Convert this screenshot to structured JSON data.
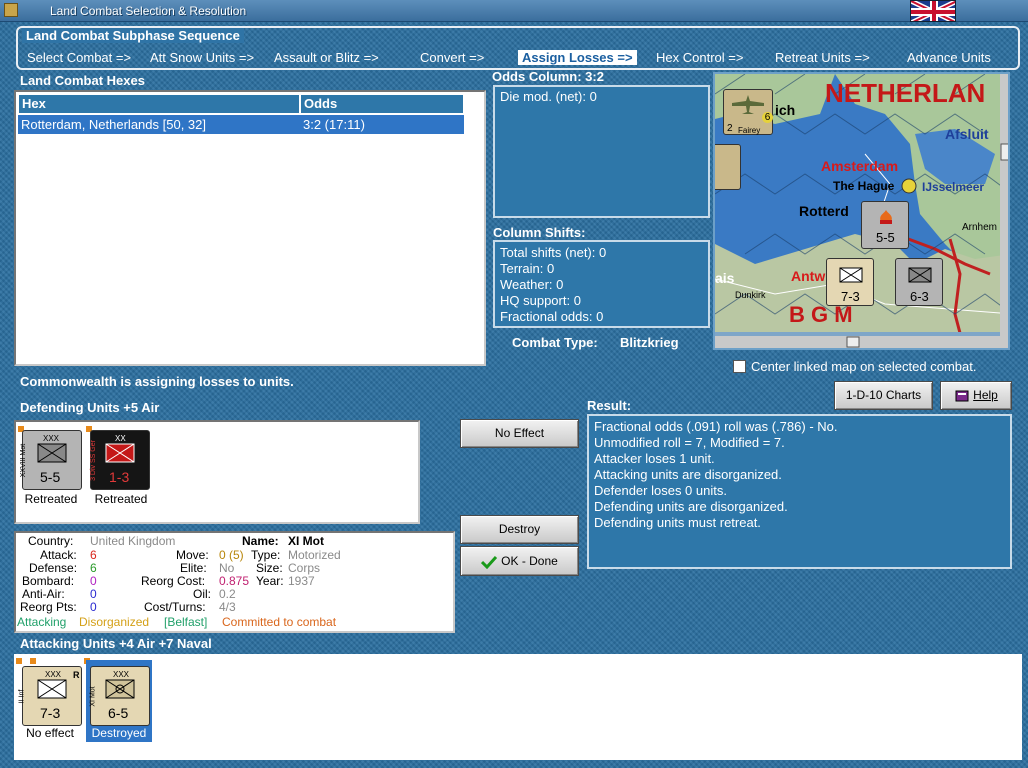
{
  "window": {
    "title": "Land Combat Selection & Resolution"
  },
  "sequence": {
    "title": "Land Combat Subphase Sequence",
    "phases": [
      {
        "label": "Select Combat =>"
      },
      {
        "label": "Att Snow Units =>"
      },
      {
        "label": "Assault or Blitz =>"
      },
      {
        "label": "Convert =>"
      },
      {
        "label": "Assign Losses =>"
      },
      {
        "label": "Hex Control =>"
      },
      {
        "label": "Retreat Units =>"
      },
      {
        "label": "Advance Units"
      }
    ],
    "active_index": 4
  },
  "hexes": {
    "title": "Land Combat Hexes",
    "columns": [
      "Hex",
      "Odds"
    ],
    "rows": [
      {
        "hex": "Rotterdam, Netherlands [50, 32]",
        "odds": "3:2 (17:11)"
      }
    ]
  },
  "odds": {
    "title": "Odds Column: 3:2",
    "die_mod": "Die mod. (net): 0"
  },
  "shifts": {
    "title": "Column Shifts:",
    "lines": [
      "Total shifts (net): 0",
      "Terrain: 0",
      "Weather: 0",
      "HQ support: 0",
      "Fractional odds: 0"
    ]
  },
  "combat_type": {
    "label": "Combat Type:",
    "value": "Blitzkrieg"
  },
  "map": {
    "labels": {
      "netherlands": "NETHERLAN",
      "amsterdam": "Amsterdam",
      "the_hague": "The Hague",
      "ijsselmeer": "IJsselmeer",
      "rotterdam": "Rotterd",
      "afsluit": "Afsluit",
      "arnhem": "Arnhem",
      "antw": "Antw",
      "dunkirk": "Dunkirk",
      "ais": "ais",
      "ich": "ich",
      "belgium": "B   G  M"
    },
    "counters": {
      "fairey": {
        "name": "Fairey",
        "top": "2",
        "right": "6"
      },
      "mid_unit": {
        "value": "5-5"
      },
      "left_unit": {
        "value": "7-3"
      },
      "right_unit": {
        "value": "6-3"
      }
    },
    "center_checkbox": "Center linked map on selected combat.",
    "center_checked": false
  },
  "status_message": "Commonwealth is assigning losses to units.",
  "defending": {
    "title": "Defending Units +5 Air",
    "units": [
      {
        "value": "5-5",
        "side": "XXVIII Mot",
        "size": "XXX",
        "label": "Retreated",
        "color": "#b4b4b4"
      },
      {
        "value": "1-3",
        "side": "3 Div SS Ger",
        "size": "XX",
        "label": "Retreated",
        "color": "#151515"
      }
    ]
  },
  "buttons": {
    "charts": "1-D-10 Charts",
    "help": "Help",
    "no_effect": "No Effect",
    "destroy": "Destroy",
    "ok_done": "OK - Done"
  },
  "result": {
    "title": "Result:",
    "lines": [
      "Fractional odds (.091) roll was (.786)  - No.",
      "Unmodified roll = 7, Modified = 7.",
      "Attacker loses 1 unit.",
      "Attacking units are disorganized.",
      "Defender loses 0 units.",
      "Defending units are disorganized.",
      "Defending units must retreat."
    ]
  },
  "unit_info": {
    "country_label": "Country:",
    "country": "United Kingdom",
    "name_label": "Name:",
    "name": "XI Mot",
    "attack_label": "Attack:",
    "attack": "6",
    "move_label": "Move:",
    "move": "0 (5)",
    "type_label": "Type:",
    "type": "Motorized",
    "defense_label": "Defense:",
    "defense": "6",
    "elite_label": "Elite:",
    "elite": "No",
    "size_label": "Size:",
    "size": "Corps",
    "bombard_label": "Bombard:",
    "bombard": "0",
    "reorg_cost_label": "Reorg Cost:",
    "reorg_cost": "0.875",
    "year_label": "Year:",
    "year": "1937",
    "antiair_label": "Anti-Air:",
    "antiair": "0",
    "oil_label": "Oil:",
    "oil": "0.2",
    "reorg_pts_label": "Reorg Pts:",
    "reorg_pts": "0",
    "cost_turns_label": "Cost/Turns:",
    "cost_turns": "4/3",
    "status_attacking": "Attacking",
    "status_disorganized": "Disorganized",
    "status_location": "[Belfast]",
    "status_committed": "Committed to combat"
  },
  "attacking": {
    "title": "Attacking Units +4 Air +7 Naval",
    "units": [
      {
        "value": "7-3",
        "side": "II Inf",
        "size": "XXX",
        "flag": "R",
        "label": "No effect",
        "selected": false
      },
      {
        "value": "6-5",
        "side": "XI Mot",
        "size": "XXX",
        "flag": "",
        "label": "Destroyed",
        "selected": true
      }
    ]
  },
  "colors": {
    "attack": "#d9261c",
    "defense": "#2a9a2a",
    "bombard": "#b020c0",
    "antiair": "#2a2ad0",
    "reorg": "#c02070",
    "grey_value": "#8a8a8a",
    "move": "#b8860b",
    "disorganized": "#d4a017",
    "attacking": "#21a06a",
    "location": "#21a06a",
    "committed": "#d9661c"
  }
}
